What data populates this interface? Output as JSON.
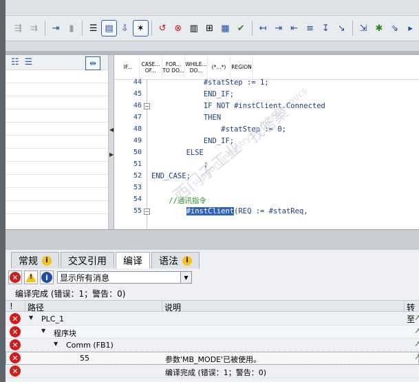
{
  "toolbar": {
    "icons": [
      "indent-increase-gray-icon",
      "indent-decrease-gray-icon",
      "insert-block-icon",
      "comment-icon",
      "list-view-icon",
      "structured-view-icon",
      "monitor-icon",
      "star-box-icon",
      "disconnect-icon",
      "break-icon",
      "program-icon",
      "call-icon",
      "stack-icon",
      "download-check-icon",
      "goto-begin-icon",
      "indent-right-icon",
      "indent-left-icon",
      "block-icon",
      "step-icon",
      "jump-icon",
      "point-icon",
      "point-next-icon",
      "pause-icon"
    ]
  },
  "sidebar": {
    "tools": [
      "align-icon",
      "list-icon"
    ],
    "toggle_icon": "arrows-icon"
  },
  "keywords": [
    "IF...",
    "CASE... OF...",
    "FOR... TO DO...",
    "WHILE... DO...",
    "(*...*)",
    "REGION"
  ],
  "code": {
    "lines": [
      {
        "num": "44",
        "text": "            #statStep := 1;"
      },
      {
        "num": "45",
        "text": "            END_IF;"
      },
      {
        "num": "46",
        "text": "            IF NOT #instClient.Connected"
      },
      {
        "num": "47",
        "text": "            THEN"
      },
      {
        "num": "48",
        "text": "                #statStep := 0;"
      },
      {
        "num": "49",
        "text": "            END_IF;"
      },
      {
        "num": "50",
        "text": "        ELSE"
      },
      {
        "num": "51",
        "text": "            ;"
      },
      {
        "num": "52",
        "text": "END_CASE;"
      },
      {
        "num": "53",
        "text": ""
      },
      {
        "num": "54",
        "text": "    //通讯指令"
      },
      {
        "num": "55",
        "pre": "        ",
        "highlight": "#instClient",
        "post": "(REQ := #statReq,"
      }
    ]
  },
  "watermark": {
    "line1": "西门子工业",
    "line2": "support.industry.siemens.com/cs",
    "line3": "找答案"
  },
  "tabs": [
    {
      "label": "常规",
      "has_info": true
    },
    {
      "label": "交叉引用",
      "has_info": false
    },
    {
      "label": "编译",
      "has_info": false,
      "active": true
    },
    {
      "label": "语法",
      "has_info": true
    }
  ],
  "filter": {
    "error_icon": "error-icon",
    "warning_icon": "warning-icon",
    "info_icon": "info-icon",
    "select_value": "显示所有消息"
  },
  "summary": "编译完成 (错误：1；警告：0)",
  "columns": {
    "bang": "!",
    "path": "路径",
    "desc": "说明",
    "goto": "转至"
  },
  "rows": [
    {
      "path": "PLC_1",
      "indent": 1,
      "expand": true,
      "desc": ""
    },
    {
      "path": "程序块",
      "indent": 2,
      "expand": true,
      "desc": ""
    },
    {
      "path": "Comm (FB1)",
      "indent": 3,
      "expand": true,
      "desc": ""
    },
    {
      "path": "55",
      "indent": 4,
      "expand": false,
      "desc": "参数'MB_MODE'已被使用。"
    },
    {
      "path": "",
      "indent": 0,
      "expand": false,
      "desc": "编译完成 (错误：1；警告：0)"
    }
  ]
}
